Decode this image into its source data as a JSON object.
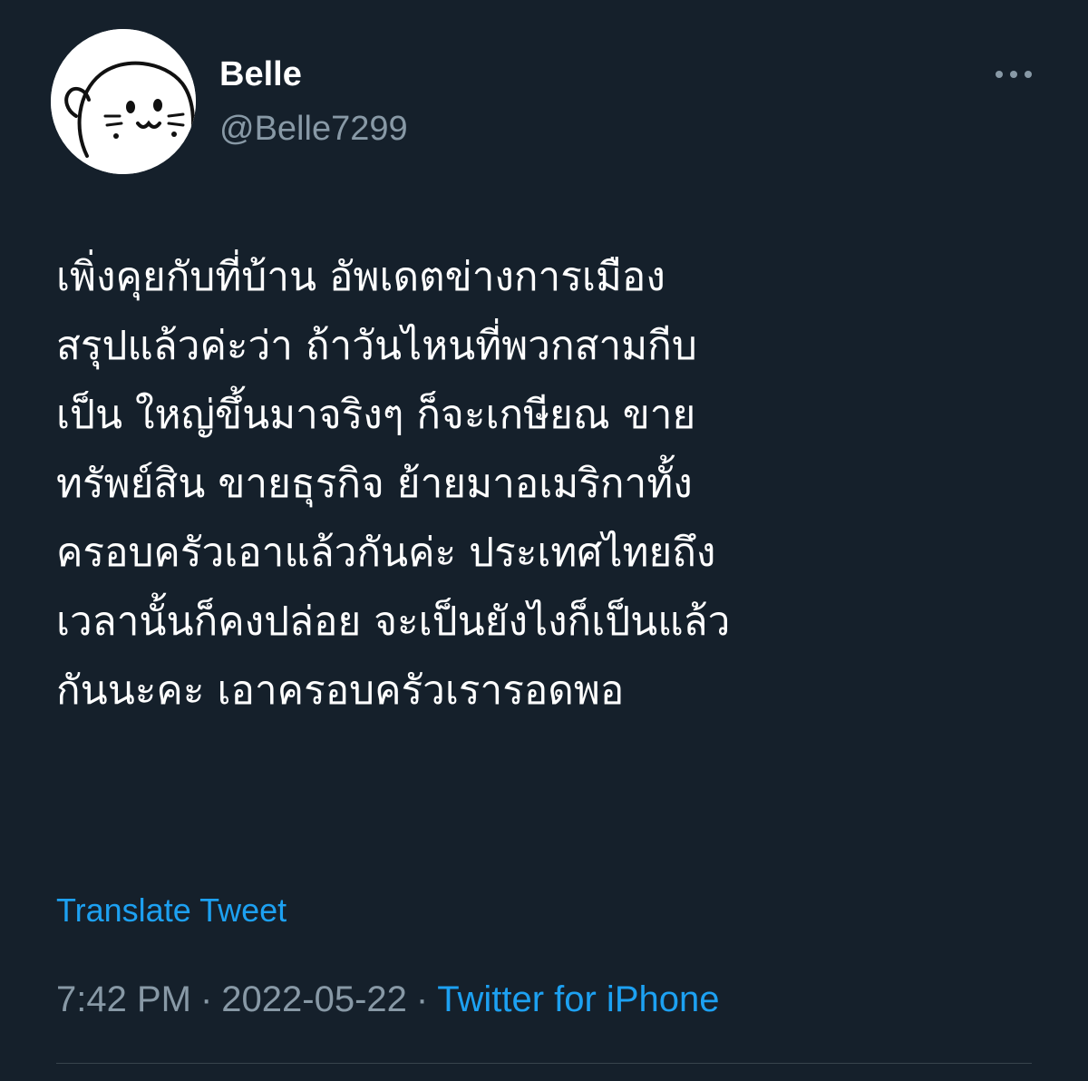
{
  "user": {
    "display_name": "Belle",
    "handle": "@Belle7299",
    "avatar_icon": "seal-avatar-icon"
  },
  "more_icon": "more-dots-icon",
  "tweet": {
    "lines": [
      "เพิ่งคุยกับที่บ้าน อัพเดตข่างการเมือง",
      "สรุปแล้วค่ะว่า ถ้าวันไหนที่พวกสามกีบ",
      "เป็น ใหญ่ขึ้นมาจริงๆ ก็จะเกษียณ ขาย",
      "ทรัพย์สิน ขายธุรกิจ ย้ายมาอเมริกาทั้ง",
      "ครอบครัวเอาแล้วกันค่ะ ประเทศไทยถึง",
      "เวลานั้นก็คงปล่อย จะเป็นยังไงก็เป็นแล้ว",
      "กันนะคะ เอาครอบครัวเรารอดพอ"
    ],
    "translate_label": "Translate Tweet",
    "time": "7:42 PM",
    "separator": "·",
    "date": "2022-05-22",
    "source": "Twitter for iPhone"
  },
  "colors": {
    "background": "#15202b",
    "link": "#1da1f2",
    "secondary_text": "#8899a6"
  }
}
